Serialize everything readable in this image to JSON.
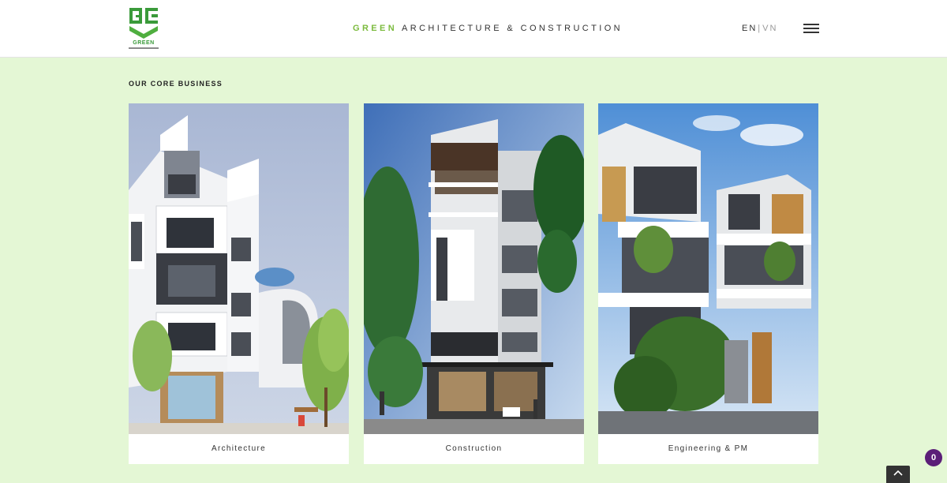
{
  "header": {
    "logo_text": "GREEN",
    "title_accent": "GREEN",
    "title_rest": "ARCHITECTURE & CONSTRUCTION",
    "lang_en": "EN",
    "lang_sep": "|",
    "lang_vn": "VN"
  },
  "section": {
    "title": "OUR CORE BUSINESS"
  },
  "cards": [
    {
      "label": "Architecture"
    },
    {
      "label": "Construction"
    },
    {
      "label": "Engineering & PM"
    }
  ],
  "chat": {
    "count": "0"
  },
  "colors": {
    "accent": "#7cbb3e",
    "page_background": "#e4f7d5",
    "badge": "#5b1e78"
  }
}
